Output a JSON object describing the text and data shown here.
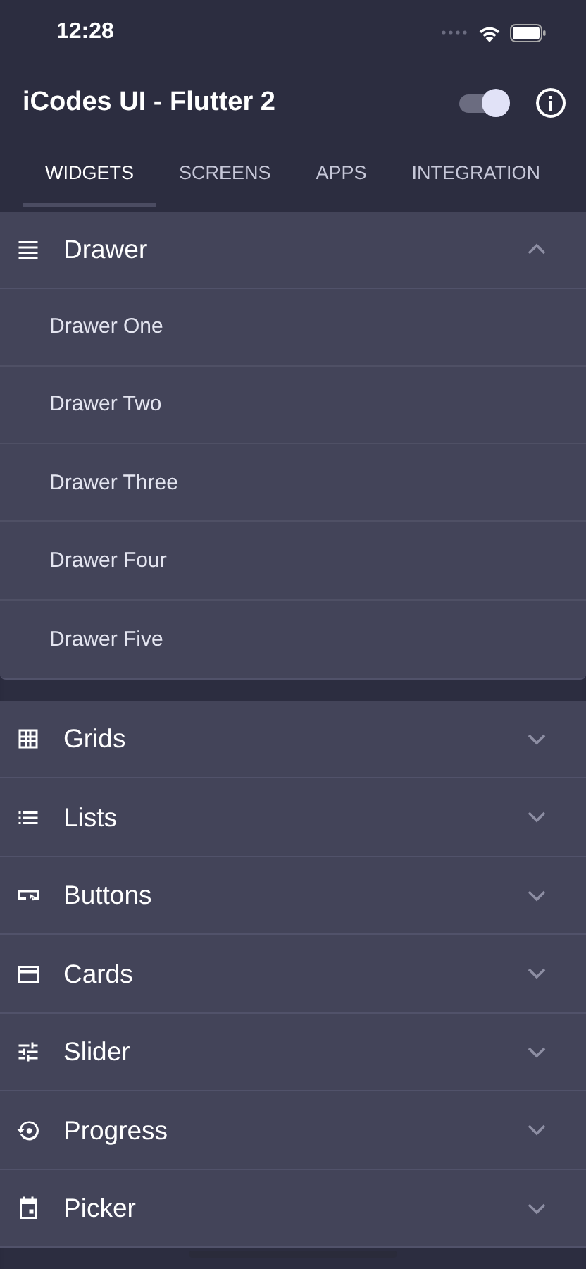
{
  "status_bar": {
    "time": "12:28"
  },
  "app_bar": {
    "title": "iCodes UI - Flutter 2",
    "theme_toggle": {
      "on": true
    }
  },
  "tabs": [
    {
      "label": "WIDGETS",
      "selected": true
    },
    {
      "label": "SCREENS",
      "selected": false
    },
    {
      "label": "APPS",
      "selected": false
    },
    {
      "label": "INTEGRATION",
      "selected": false
    }
  ],
  "sections": [
    {
      "title": "Drawer",
      "expanded": true,
      "children": [
        {
          "label": "Drawer One"
        },
        {
          "label": "Drawer Two"
        },
        {
          "label": "Drawer Three"
        },
        {
          "label": "Drawer Four"
        },
        {
          "label": "Drawer Five"
        }
      ]
    },
    {
      "title": "Grids",
      "expanded": false
    },
    {
      "title": "Lists",
      "expanded": false
    },
    {
      "title": "Buttons",
      "expanded": false
    },
    {
      "title": "Cards",
      "expanded": false
    },
    {
      "title": "Slider",
      "expanded": false
    },
    {
      "title": "Progress",
      "expanded": false
    },
    {
      "title": "Picker",
      "expanded": false
    }
  ]
}
